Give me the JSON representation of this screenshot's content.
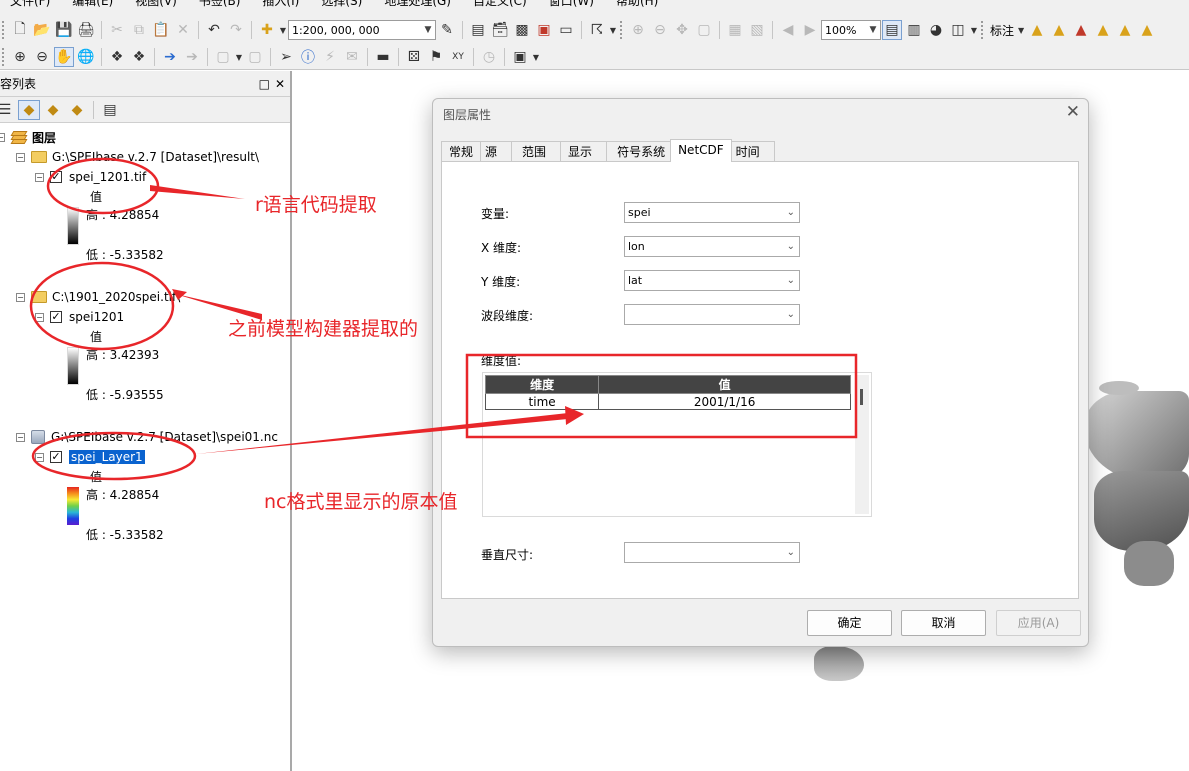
{
  "menu": [
    "文件(F)",
    "编辑(E)",
    "视图(V)",
    "书签(B)",
    "插入(I)",
    "选择(S)",
    "地理处理(G)",
    "自定义(C)",
    "窗口(W)",
    "帮助(H)"
  ],
  "toolbar": {
    "scale_value": "1:200, 000, 000",
    "zoom_value": "100%",
    "label_menu": "标注"
  },
  "toc": {
    "title": "内容列表",
    "root_label": "图层",
    "value_label": "值",
    "groups": [
      {
        "source": "G:\\SPEIbase v.2.7 [Dataset]\\result\\",
        "layer": "spei_1201.tif",
        "high": "高 : 4.28854",
        "low": "低 : -5.33582"
      },
      {
        "source": "C:\\1901_2020spei.tif\\",
        "layer": "spei1201",
        "high": "高 : 3.42393",
        "low": "低 : -5.93555"
      },
      {
        "source": "G:\\SPEIbase v.2.7 [Dataset]\\spei01.nc",
        "layer": "spei_Layer1",
        "high": "高 : 4.28854",
        "low": "低 : -5.33582"
      }
    ]
  },
  "dialog": {
    "title": "图层属性",
    "tabs": [
      "常规",
      "源",
      "范围",
      "显示",
      "符号系统",
      "NetCDF",
      "时间"
    ],
    "active_tab": "NetCDF",
    "fields": {
      "variable_label": "变量:",
      "variable_value": "spei",
      "x_label": "X 维度:",
      "x_value": "lon",
      "y_label": "Y 维度:",
      "y_value": "lat",
      "band_label": "波段维度:",
      "band_value": "",
      "dim_values_label": "维度值:",
      "vertical_label": "垂直尺寸:",
      "vertical_value": ""
    },
    "dim_table": {
      "headers": [
        "维度",
        "值"
      ],
      "rows": [
        [
          "time",
          "2001/1/16"
        ]
      ]
    },
    "buttons": {
      "ok": "确定",
      "cancel": "取消",
      "apply": "应用(A)"
    }
  },
  "annotations": {
    "a1": "r语言代码提取",
    "a2": "之前模型构建器提取的",
    "a3": "nc格式里显示的原本值",
    "color": "#e8262a"
  }
}
